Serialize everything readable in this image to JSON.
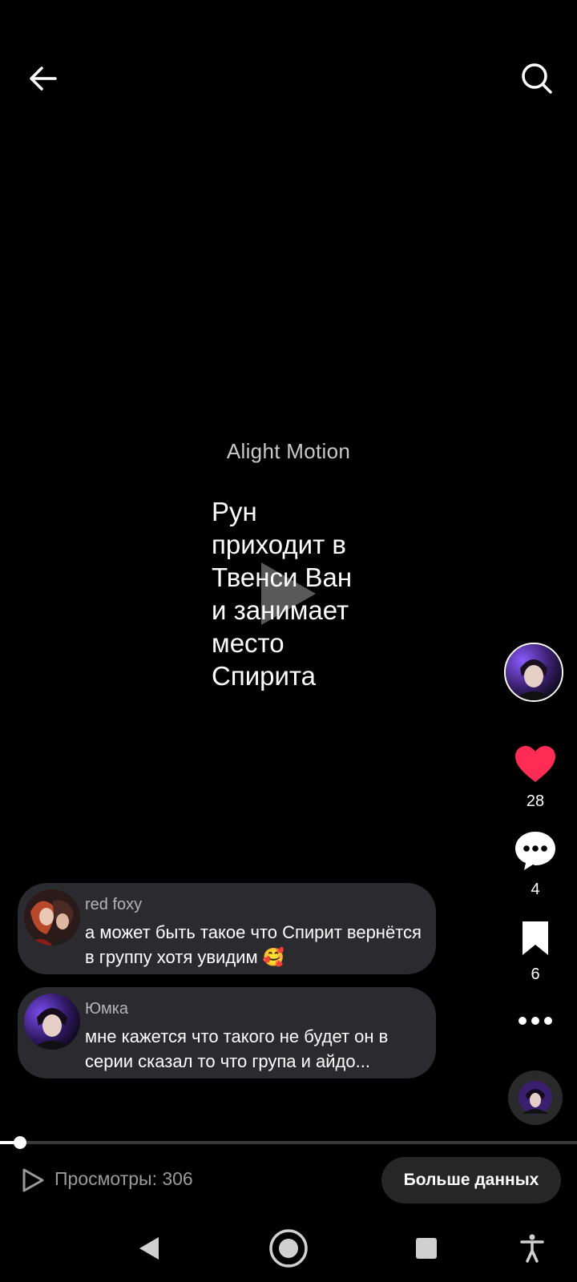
{
  "video": {
    "watermark": "Alight Motion",
    "caption": "Рун\nприходит в\nТвенси Ван\nи занимает\nместо\nСпирита",
    "progress": 0.035
  },
  "actions": {
    "likes": "28",
    "comments": "4",
    "bookmarks": "6"
  },
  "comments": [
    {
      "user": "red foxy",
      "text": "а может быть такое что Спирит вернётся в группу хотя увидим 🥰"
    },
    {
      "user": "Юмка",
      "text": "мне кажется что такого не будет он в серии сказал то что група и айдо..."
    }
  ],
  "footer": {
    "views": "Просмотры: 306",
    "more_data": "Больше данных"
  },
  "colors": {
    "like": "#fe2c55",
    "background": "#000000",
    "comment_bg": "#2b2a2e"
  },
  "icons": [
    "back-arrow-icon",
    "search-icon",
    "play-icon",
    "heart-icon",
    "comment-icon",
    "bookmark-icon",
    "more-icon",
    "play-outline-icon",
    "nav-back-icon",
    "nav-home-icon",
    "nav-recents-icon",
    "accessibility-icon"
  ]
}
